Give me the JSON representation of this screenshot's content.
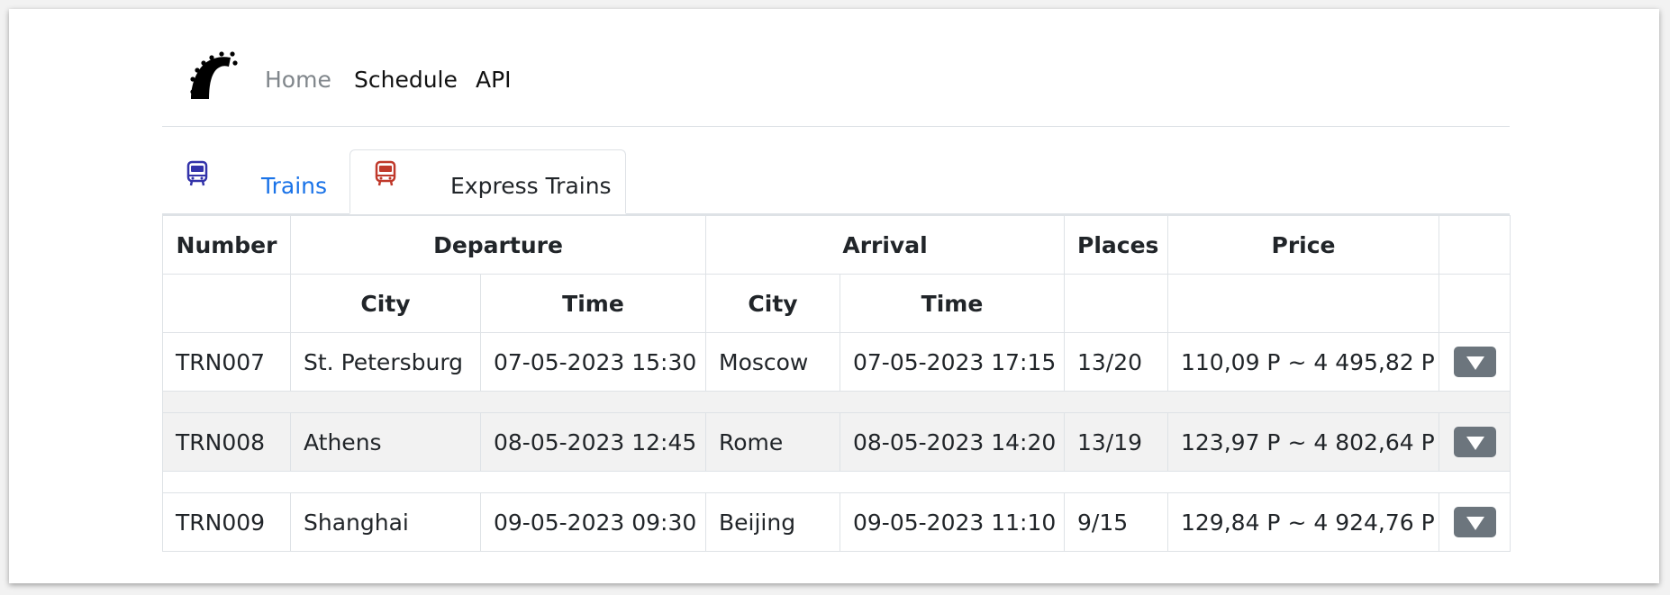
{
  "nav": {
    "logo_icon": "railway-logo-icon",
    "links": [
      "Home",
      "Schedule",
      "API"
    ]
  },
  "tabs": [
    {
      "label": "Trains",
      "icon": "bus-icon",
      "color": "#3333aa",
      "active": false
    },
    {
      "label": "Express Trains",
      "icon": "bus-icon",
      "color": "#c0392b",
      "active": true
    }
  ],
  "table": {
    "group_headers": [
      "Number",
      "Departure",
      "Arrival",
      "Places",
      "Price",
      ""
    ],
    "sub_headers": [
      "",
      "City",
      "Time",
      "City",
      "Time",
      "",
      "",
      ""
    ],
    "rows": [
      {
        "number": "TRN007",
        "dep_city": "St. Petersburg",
        "dep_time": "07-05-2023 15:30",
        "arr_city": "Moscow",
        "arr_time": "07-05-2023 17:15",
        "places": "13/20",
        "price": "110,09 P ~ 4 495,82 P"
      },
      {
        "number": "TRN008",
        "dep_city": "Athens",
        "dep_time": "08-05-2023 12:45",
        "arr_city": "Rome",
        "arr_time": "08-05-2023 14:20",
        "places": "13/19",
        "price": "123,97 P ~ 4 802,64 P"
      },
      {
        "number": "TRN009",
        "dep_city": "Shanghai",
        "dep_time": "09-05-2023 09:30",
        "arr_city": "Beijing",
        "arr_time": "09-05-2023 11:10",
        "places": "9/15",
        "price": "129,84 P ~ 4 924,76 P"
      }
    ],
    "row_button_icon": "caret-down-icon"
  },
  "colors": {
    "link": "#1a73e8",
    "muted": "#80868b",
    "button": "#6c757d",
    "stripe": "#f2f2f2"
  }
}
